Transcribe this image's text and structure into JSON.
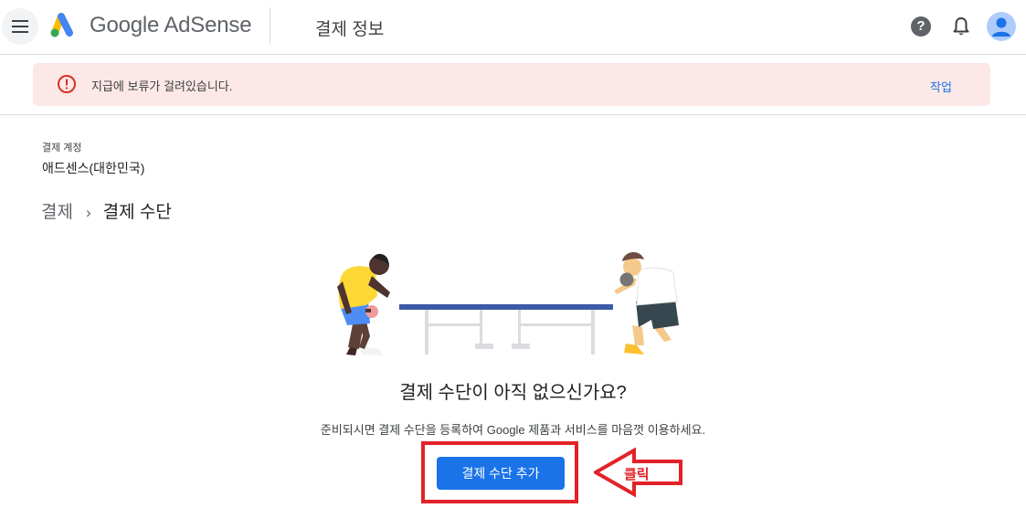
{
  "header": {
    "logo_text": "Google AdSense",
    "page_title": "결제 정보",
    "help_glyph": "?"
  },
  "alert": {
    "message": "지급에 보류가 걸려있습니다.",
    "action_label": "작업",
    "accent_color": "#d93025"
  },
  "account": {
    "label": "결제 계정",
    "value": "애드센스(대한민국)"
  },
  "breadcrumb": {
    "parent": "결제",
    "separator": "›",
    "current": "결제 수단"
  },
  "empty_state": {
    "title": "결제 수단이 아직 없으신가요?",
    "description": "준비되시면 결제 수단을 등록하여 Google 제품과 서비스를 마음껏 이용하세요.",
    "button_label": "결제 수단 추가"
  },
  "annotation": {
    "label": "클릭",
    "color": "#e32228"
  },
  "colors": {
    "primary": "#1a73e8",
    "alert_bg": "#fce8e6"
  }
}
